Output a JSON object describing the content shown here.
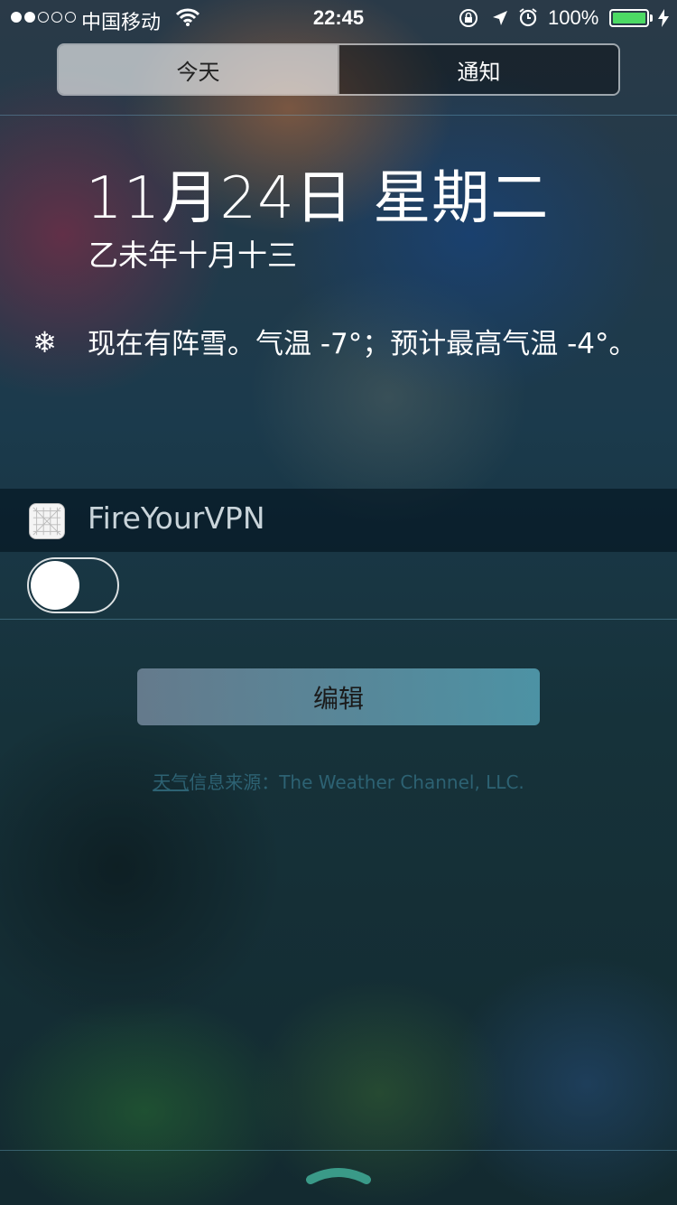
{
  "status_bar": {
    "signal_dots_filled": 2,
    "signal_dots_total": 5,
    "carrier": "中国移动",
    "time": "22:45",
    "battery_percent": "100%",
    "icons": [
      "wifi-icon",
      "rotation-lock-icon",
      "location-icon",
      "alarm-icon",
      "charging-icon"
    ]
  },
  "tabs": {
    "today": "今天",
    "notifications": "通知"
  },
  "today": {
    "date": "11月24日 星期二",
    "lunar_date": "乙未年十月十三",
    "weather_icon": "snowflake-icon",
    "weather_text": "现在有阵雪。气温 -7°；预计最高气温 -4°。"
  },
  "widget": {
    "app_name": "FireYourVPN",
    "toggle_on": false
  },
  "edit_button": "编辑",
  "weather_source": {
    "link": "天气",
    "text": "信息来源：The Weather Channel, LLC."
  },
  "colors": {
    "battery": "#4cd964",
    "source_text": "#2d6273"
  }
}
